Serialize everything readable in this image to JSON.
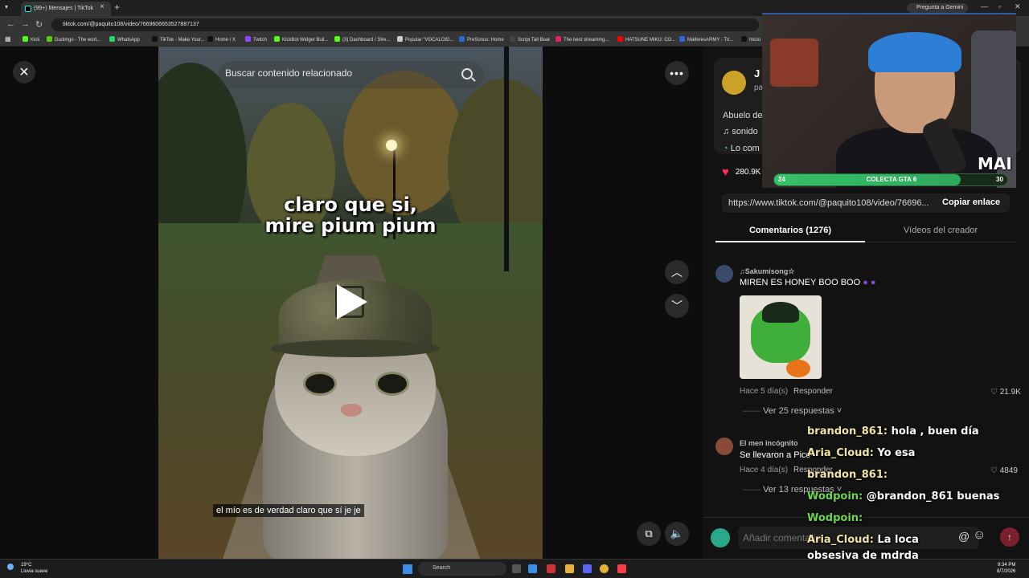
{
  "browser": {
    "tab_title": "(99+) Mensajes | TikTok",
    "url": "tiktok.com/@paquito108/video/7669606653527887137",
    "gemini_label": "Pregunta a Gemini",
    "bookmarks": [
      {
        "label": "Kick",
        "color": "#53fc18"
      },
      {
        "label": "Duolingo - The worl...",
        "color": "#58cc02"
      },
      {
        "label": "WhatsApp",
        "color": "#25d366"
      },
      {
        "label": "TikTok - Make Your...",
        "color": "#111111"
      },
      {
        "label": "Home / X",
        "color": "#111111"
      },
      {
        "label": "Twitch",
        "color": "#9146ff"
      },
      {
        "label": "KickBot Widget Buil...",
        "color": "#53fc18"
      },
      {
        "label": "(3) Dashboard / Stre...",
        "color": "#53fc18"
      },
      {
        "label": "Popular \"VOCALOID...",
        "color": "#cccccc"
      },
      {
        "label": "PreSonus: Home",
        "color": "#2a6ad0"
      },
      {
        "label": "Script Tall Beat",
        "color": "#444444"
      },
      {
        "label": "The best streaming...",
        "color": "#e0245e"
      },
      {
        "label": "HATSUNE MIKU: CO...",
        "color": "#ff0000"
      },
      {
        "label": "MaiferesARMY - Tri...",
        "color": "#2a6ad0"
      },
      {
        "label": "Inicio",
        "color": "#111111"
      }
    ]
  },
  "video": {
    "search_placeholder": "Buscar contenido relacionado",
    "caption_line1": "claro que si,",
    "caption_line2": "mire pium pium",
    "subtitle": "el mío es de verdad claro que sí je je"
  },
  "author": {
    "name": "J",
    "handle": "pa",
    "description": "Abuelo de",
    "sound": "sonido",
    "lo_com": "Lo com"
  },
  "stats": {
    "likes": "280.9K"
  },
  "share": {
    "link": "https://www.tiktok.com/@paquito108/video/76696...",
    "copy_label": "Copiar enlace"
  },
  "tabs": {
    "comments": "Comentarios (1276)",
    "creator_videos": "Vídeos del creador"
  },
  "comments": [
    {
      "user": "♫Sakumisong☆",
      "text": "MIREN ES HONEY BOO BOO",
      "time": "Hace 5 día(s)",
      "reply_label": "Responder",
      "likes": "21.9K",
      "replies": "Ver 25 respuestas"
    },
    {
      "user": "El men incógnito",
      "text": "Se llevaron a Pico",
      "time": "Hace 4 día(s)",
      "reply_label": "Responder",
      "likes": "4849",
      "replies": "Ver 13 respuestas"
    }
  ],
  "comment_box": {
    "placeholder": "Añadir comentario..."
  },
  "stream_overlay": {
    "webcam_label": "MAI",
    "goal_label": "COLECTA GTA 6",
    "goal_current": "24",
    "goal_target": "30",
    "goal_progress": 0.8,
    "chat": [
      {
        "user": "brandon_861:",
        "message": "hola , buen día",
        "color": "#f1e5a0"
      },
      {
        "user": "Aria_Cloud:",
        "message": "Yo esa",
        "color": "#f1e5a0"
      },
      {
        "user": "brandon_861:",
        "message": "",
        "color": "#f1e5a0"
      },
      {
        "user": "Wodpoin:",
        "message": "@brandon_861 buenas",
        "color": "#6ad94a"
      },
      {
        "user": "Wodpoin:",
        "message": "",
        "color": "#6ad94a"
      },
      {
        "user": "Aria_Cloud:",
        "message": "La loca",
        "color": "#f1e5a0"
      },
      {
        "user": "",
        "message": "obsesiva de mdrda",
        "color": "#ffffff"
      }
    ]
  },
  "taskbar": {
    "temperature": "19°C",
    "weather": "Lluvia suave",
    "search": "Search",
    "time": "9:34 PM",
    "date": "8/7/2026"
  }
}
